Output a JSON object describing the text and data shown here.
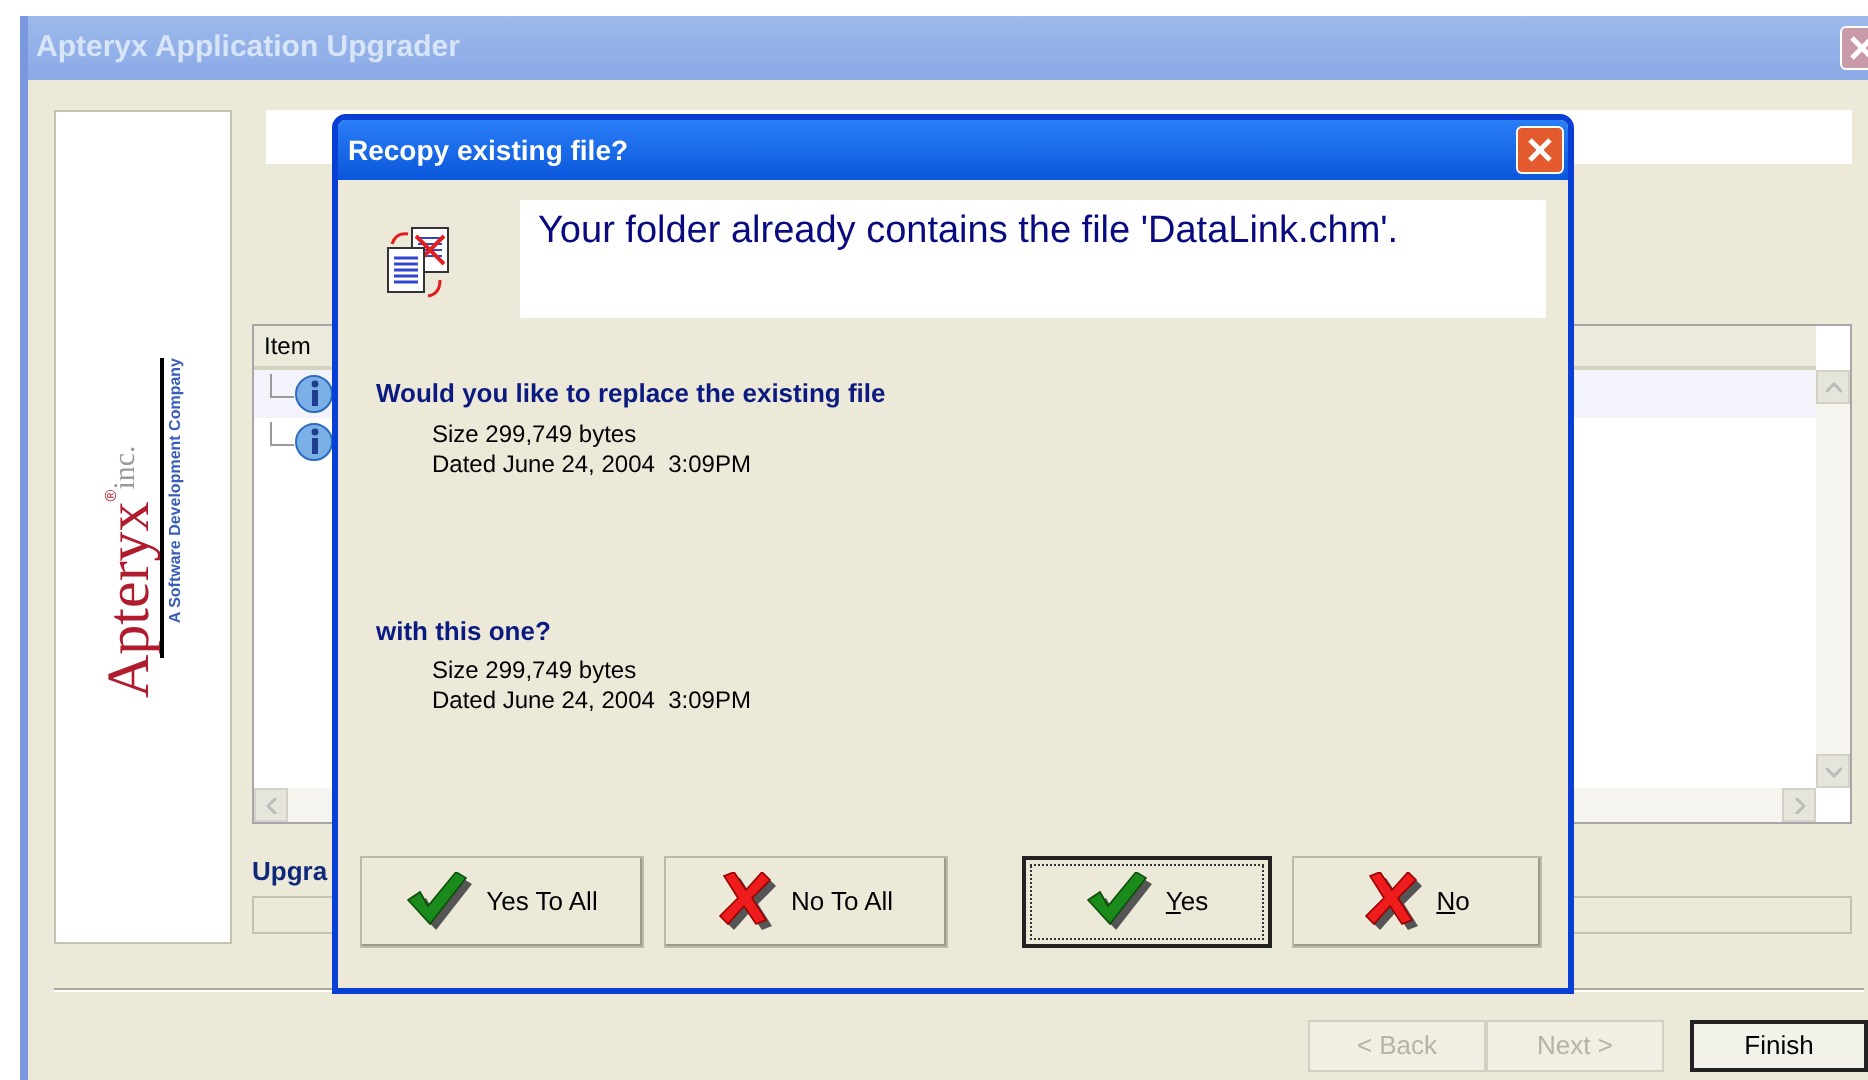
{
  "window": {
    "title": "Apteryx Application Upgrader",
    "active": false
  },
  "logo": {
    "name": "Apteryx",
    "registered": "®",
    "suffix": "inc.",
    "tagline": "A Software Development Company"
  },
  "list": {
    "columns": [
      "Item"
    ],
    "rows": [
      {
        "selected": true
      },
      {
        "selected": false
      }
    ]
  },
  "progress_label": "Upgra",
  "progress": {
    "level": 0
  },
  "footer_buttons": [
    {
      "label": "< Back",
      "disabled": true,
      "default": false
    },
    {
      "label": "Next >",
      "disabled": true,
      "default": false
    },
    {
      "label": "Finish",
      "disabled": false,
      "default": true
    }
  ],
  "dialog": {
    "title": "Recopy existing file?",
    "message": "Your folder already contains the file 'DataLink.chm'.",
    "existing": {
      "question": "Would you like to replace the existing file",
      "size": "Size 299,749 bytes",
      "date": "Dated June 24, 2004  3:09PM"
    },
    "replacement": {
      "question": "with this one?",
      "size": "Size 299,749 bytes",
      "date": "Dated June 24, 2004  3:09PM"
    },
    "buttons": [
      {
        "label": "Yes To All",
        "kind": "check",
        "default": false,
        "underline": false
      },
      {
        "label": "No To All",
        "kind": "cross",
        "default": false,
        "underline": false
      },
      {
        "label": "Yes",
        "kind": "check",
        "default": true,
        "underline": true
      },
      {
        "label": "No",
        "kind": "cross",
        "default": false,
        "underline": true
      }
    ]
  }
}
